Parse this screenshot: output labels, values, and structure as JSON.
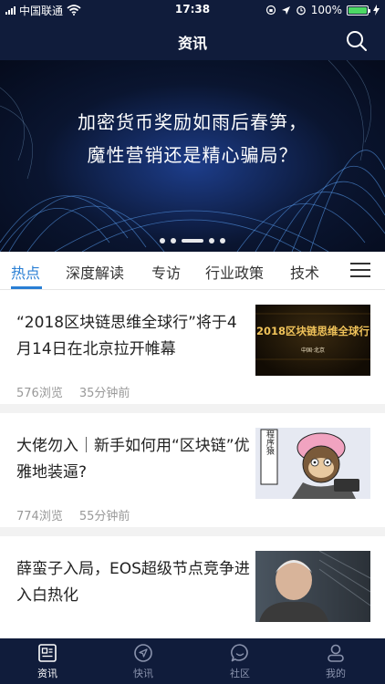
{
  "status_bar": {
    "carrier": "中国联通",
    "time": "17:38",
    "battery": "100%",
    "battery_level": 1.0
  },
  "nav": {
    "title": "资讯",
    "search_icon": "search-icon"
  },
  "banner": {
    "line1": "加密货币奖励如雨后春笋，",
    "line2": "魔性营销还是精心骗局？",
    "slide_count": 5,
    "active_slide": 3
  },
  "tabs": [
    {
      "label": "热点",
      "active": true
    },
    {
      "label": "深度解读",
      "active": false
    },
    {
      "label": "专访",
      "active": false
    },
    {
      "label": "行业政策",
      "active": false
    },
    {
      "label": "技术",
      "active": false
    }
  ],
  "articles": [
    {
      "title": "“2018区块链思维全球行”将于4月14日在北京拉开帷幕",
      "views": "576浏览",
      "time": "35分钟前",
      "thumb": {
        "line1": "2018区块链思维全球行",
        "line2": "中国·北京"
      }
    },
    {
      "title": "大佬勿入｜新手如何用“区块链”优雅地装逼?",
      "views": "774浏览",
      "time": "55分钟前",
      "thumb": {
        "sign": "程序猿"
      }
    },
    {
      "title": "薛蛮子入局，EOS超级节点竞争进入白热化",
      "views": "",
      "time": ""
    }
  ],
  "tabbar": [
    {
      "label": "资讯",
      "icon": "news-icon",
      "active": true
    },
    {
      "label": "快讯",
      "icon": "flash-icon",
      "active": false
    },
    {
      "label": "社区",
      "icon": "chat-icon",
      "active": false
    },
    {
      "label": "我的",
      "icon": "profile-icon",
      "active": false
    }
  ],
  "colors": {
    "nav_bg": "#101c3b",
    "accent": "#2a7fd4",
    "meta_text": "#999999"
  }
}
